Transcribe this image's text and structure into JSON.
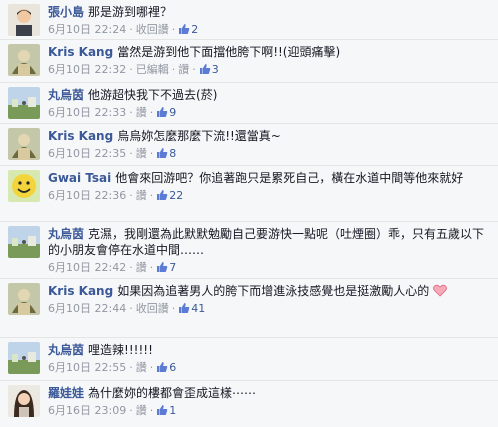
{
  "reply_label": "收回讚",
  "like_label": "讚",
  "edited_label": "已編輯",
  "separator": "·",
  "comments": [
    {
      "author": "張小島",
      "text": "那是游到哪裡？",
      "date": "6月10日 22:24",
      "likes": "2"
    },
    {
      "author": "Kris Kang",
      "text": "當然是游到他下面擋他胯下啊!!(迎頭痛擊)",
      "date": "6月10日 22:32",
      "likes": "3"
    },
    {
      "author": "丸烏茵",
      "text": "他游超快我下不過去(菸)",
      "date": "6月10日 22:33",
      "likes": "9"
    },
    {
      "author": "Kris Kang",
      "text": "烏烏妳怎麼那麼下流!!還當真~",
      "date": "6月10日 22:35",
      "likes": "8"
    },
    {
      "author": "Gwai Tsai",
      "text": "他會來回游吧？你追著跑只是累死自己，橫在水道中間等他來就好",
      "date": "6月10日 22:36",
      "likes": "22"
    },
    {
      "author": "丸烏茵",
      "text": "克濕，我剛還為此默默勉勵自己要游快一點呢（吐煙圈）乖，只有五歲以下的小朋友會停在水道中間……",
      "date": "6月10日 22:42",
      "likes": "7"
    },
    {
      "author": "Kris Kang",
      "text": "如果因為追著男人的胯下而增進泳技感覺也是挺激勵人心的",
      "date": "6月10日 22:44",
      "likes": "41"
    },
    {
      "author": "丸烏茵",
      "text": "哩造辣!!!!!!",
      "date": "6月10日 22:55",
      "likes": "6"
    },
    {
      "author": "羅娃娃",
      "text": "為什麼妳的樓都會歪成這樣⋯⋯",
      "date": "6月16日 23:09",
      "likes": "1"
    }
  ]
}
